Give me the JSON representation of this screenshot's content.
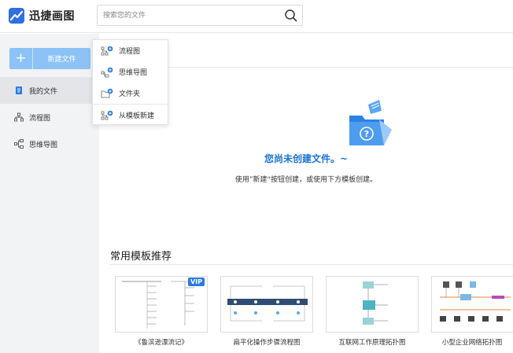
{
  "header": {
    "app_name": "迅捷画图",
    "search_placeholder": "搜索您的文件"
  },
  "sidebar": {
    "new_button": "新建文件",
    "items": [
      {
        "label": "我的文件",
        "icon": "file-icon",
        "active": true
      },
      {
        "label": "流程图",
        "icon": "flowchart-icon",
        "active": false
      },
      {
        "label": "思维导图",
        "icon": "mindmap-icon",
        "active": false
      }
    ]
  },
  "dropdown": {
    "items": [
      {
        "label": "流程图",
        "icon": "flowchart-add-icon"
      },
      {
        "label": "思维导图",
        "icon": "mindmap-add-icon"
      },
      {
        "label": "文件夹",
        "icon": "folder-add-icon"
      },
      {
        "label": "从模板新建",
        "icon": "template-add-icon"
      }
    ]
  },
  "empty_state": {
    "title": "您尚未创建文件。~",
    "subtitle": "使用”新建“按钮创建，或使用下方模板创建。"
  },
  "templates": {
    "section_title": "常用模板推荐",
    "items": [
      {
        "caption": "《鲁滨逊漂流记》",
        "vip": "VIP"
      },
      {
        "caption": "扁平化操作步骤流程图"
      },
      {
        "caption": "互联网工作原理拓扑图"
      },
      {
        "caption": "小型企业网络拓扑图"
      }
    ]
  },
  "colors": {
    "accent": "#1a73d9",
    "new_button": "#8cc2f6",
    "sidebar_bg": "#f2f3f5"
  }
}
